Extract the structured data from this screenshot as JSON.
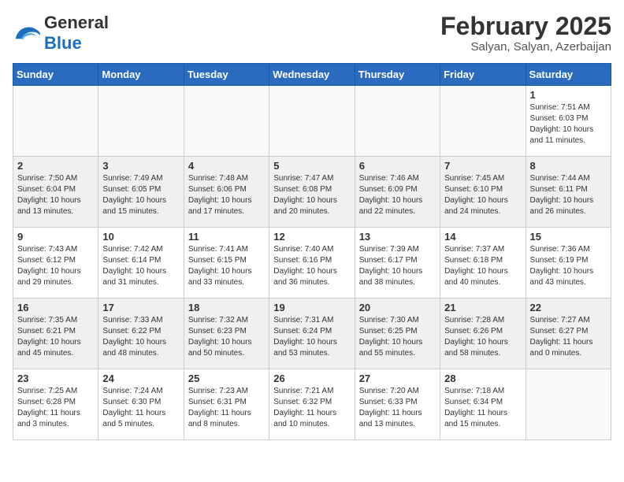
{
  "header": {
    "logo_general": "General",
    "logo_blue": "Blue",
    "title": "February 2025",
    "subtitle": "Salyan, Salyan, Azerbaijan"
  },
  "weekdays": [
    "Sunday",
    "Monday",
    "Tuesday",
    "Wednesday",
    "Thursday",
    "Friday",
    "Saturday"
  ],
  "weeks": [
    {
      "shaded": false,
      "days": [
        {
          "num": "",
          "info": ""
        },
        {
          "num": "",
          "info": ""
        },
        {
          "num": "",
          "info": ""
        },
        {
          "num": "",
          "info": ""
        },
        {
          "num": "",
          "info": ""
        },
        {
          "num": "",
          "info": ""
        },
        {
          "num": "1",
          "info": "Sunrise: 7:51 AM\nSunset: 6:03 PM\nDaylight: 10 hours\nand 11 minutes."
        }
      ]
    },
    {
      "shaded": true,
      "days": [
        {
          "num": "2",
          "info": "Sunrise: 7:50 AM\nSunset: 6:04 PM\nDaylight: 10 hours\nand 13 minutes."
        },
        {
          "num": "3",
          "info": "Sunrise: 7:49 AM\nSunset: 6:05 PM\nDaylight: 10 hours\nand 15 minutes."
        },
        {
          "num": "4",
          "info": "Sunrise: 7:48 AM\nSunset: 6:06 PM\nDaylight: 10 hours\nand 17 minutes."
        },
        {
          "num": "5",
          "info": "Sunrise: 7:47 AM\nSunset: 6:08 PM\nDaylight: 10 hours\nand 20 minutes."
        },
        {
          "num": "6",
          "info": "Sunrise: 7:46 AM\nSunset: 6:09 PM\nDaylight: 10 hours\nand 22 minutes."
        },
        {
          "num": "7",
          "info": "Sunrise: 7:45 AM\nSunset: 6:10 PM\nDaylight: 10 hours\nand 24 minutes."
        },
        {
          "num": "8",
          "info": "Sunrise: 7:44 AM\nSunset: 6:11 PM\nDaylight: 10 hours\nand 26 minutes."
        }
      ]
    },
    {
      "shaded": false,
      "days": [
        {
          "num": "9",
          "info": "Sunrise: 7:43 AM\nSunset: 6:12 PM\nDaylight: 10 hours\nand 29 minutes."
        },
        {
          "num": "10",
          "info": "Sunrise: 7:42 AM\nSunset: 6:14 PM\nDaylight: 10 hours\nand 31 minutes."
        },
        {
          "num": "11",
          "info": "Sunrise: 7:41 AM\nSunset: 6:15 PM\nDaylight: 10 hours\nand 33 minutes."
        },
        {
          "num": "12",
          "info": "Sunrise: 7:40 AM\nSunset: 6:16 PM\nDaylight: 10 hours\nand 36 minutes."
        },
        {
          "num": "13",
          "info": "Sunrise: 7:39 AM\nSunset: 6:17 PM\nDaylight: 10 hours\nand 38 minutes."
        },
        {
          "num": "14",
          "info": "Sunrise: 7:37 AM\nSunset: 6:18 PM\nDaylight: 10 hours\nand 40 minutes."
        },
        {
          "num": "15",
          "info": "Sunrise: 7:36 AM\nSunset: 6:19 PM\nDaylight: 10 hours\nand 43 minutes."
        }
      ]
    },
    {
      "shaded": true,
      "days": [
        {
          "num": "16",
          "info": "Sunrise: 7:35 AM\nSunset: 6:21 PM\nDaylight: 10 hours\nand 45 minutes."
        },
        {
          "num": "17",
          "info": "Sunrise: 7:33 AM\nSunset: 6:22 PM\nDaylight: 10 hours\nand 48 minutes."
        },
        {
          "num": "18",
          "info": "Sunrise: 7:32 AM\nSunset: 6:23 PM\nDaylight: 10 hours\nand 50 minutes."
        },
        {
          "num": "19",
          "info": "Sunrise: 7:31 AM\nSunset: 6:24 PM\nDaylight: 10 hours\nand 53 minutes."
        },
        {
          "num": "20",
          "info": "Sunrise: 7:30 AM\nSunset: 6:25 PM\nDaylight: 10 hours\nand 55 minutes."
        },
        {
          "num": "21",
          "info": "Sunrise: 7:28 AM\nSunset: 6:26 PM\nDaylight: 10 hours\nand 58 minutes."
        },
        {
          "num": "22",
          "info": "Sunrise: 7:27 AM\nSunset: 6:27 PM\nDaylight: 11 hours\nand 0 minutes."
        }
      ]
    },
    {
      "shaded": false,
      "days": [
        {
          "num": "23",
          "info": "Sunrise: 7:25 AM\nSunset: 6:28 PM\nDaylight: 11 hours\nand 3 minutes."
        },
        {
          "num": "24",
          "info": "Sunrise: 7:24 AM\nSunset: 6:30 PM\nDaylight: 11 hours\nand 5 minutes."
        },
        {
          "num": "25",
          "info": "Sunrise: 7:23 AM\nSunset: 6:31 PM\nDaylight: 11 hours\nand 8 minutes."
        },
        {
          "num": "26",
          "info": "Sunrise: 7:21 AM\nSunset: 6:32 PM\nDaylight: 11 hours\nand 10 minutes."
        },
        {
          "num": "27",
          "info": "Sunrise: 7:20 AM\nSunset: 6:33 PM\nDaylight: 11 hours\nand 13 minutes."
        },
        {
          "num": "28",
          "info": "Sunrise: 7:18 AM\nSunset: 6:34 PM\nDaylight: 11 hours\nand 15 minutes."
        },
        {
          "num": "",
          "info": ""
        }
      ]
    }
  ]
}
